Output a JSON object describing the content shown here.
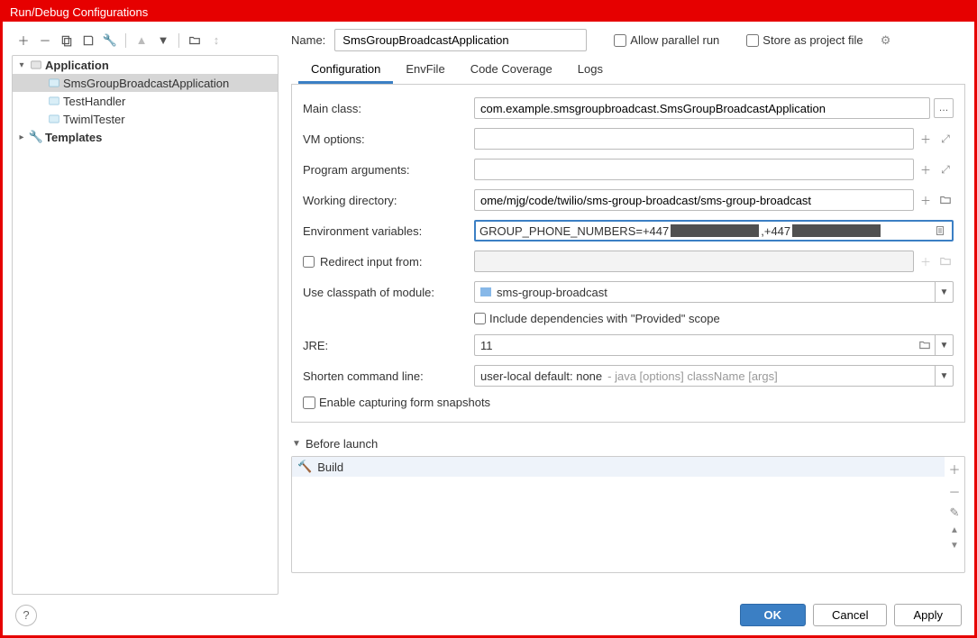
{
  "window": {
    "title": "Run/Debug Configurations"
  },
  "name": {
    "label": "Name:",
    "value": "SmsGroupBroadcastApplication",
    "allow_parallel": "Allow parallel run",
    "store_as_file": "Store as project file"
  },
  "sidebar": {
    "app_node": "Application",
    "items": [
      "SmsGroupBroadcastApplication",
      "TestHandler",
      "TwimlTester"
    ],
    "templates": "Templates"
  },
  "tabs": [
    "Configuration",
    "EnvFile",
    "Code Coverage",
    "Logs"
  ],
  "form": {
    "main_class": {
      "label": "Main class:",
      "value": "com.example.smsgroupbroadcast.SmsGroupBroadcastApplication"
    },
    "vm_options": {
      "label": "VM options:"
    },
    "program_args": {
      "label": "Program arguments:"
    },
    "working_dir": {
      "label": "Working directory:",
      "value": "ome/mjg/code/twilio/sms-group-broadcast/sms-group-broadcast"
    },
    "env_vars": {
      "label": "Environment variables:",
      "prefix": "GROUP_PHONE_NUMBERS=+447",
      "mid": ",+447"
    },
    "redirect_input": {
      "label": "Redirect input from:"
    },
    "classpath": {
      "label": "Use classpath of module:",
      "value": "sms-group-broadcast"
    },
    "include_deps": "Include dependencies with \"Provided\" scope",
    "jre": {
      "label": "JRE:",
      "value": "11"
    },
    "shorten": {
      "label": "Shorten command line:",
      "value": "user-local default: none",
      "hint": " - java [options] className [args]"
    },
    "enable_snapshots": "Enable capturing form snapshots"
  },
  "before_launch": {
    "header": "Before launch",
    "item": "Build"
  },
  "footer": {
    "ok": "OK",
    "cancel": "Cancel",
    "apply": "Apply"
  }
}
